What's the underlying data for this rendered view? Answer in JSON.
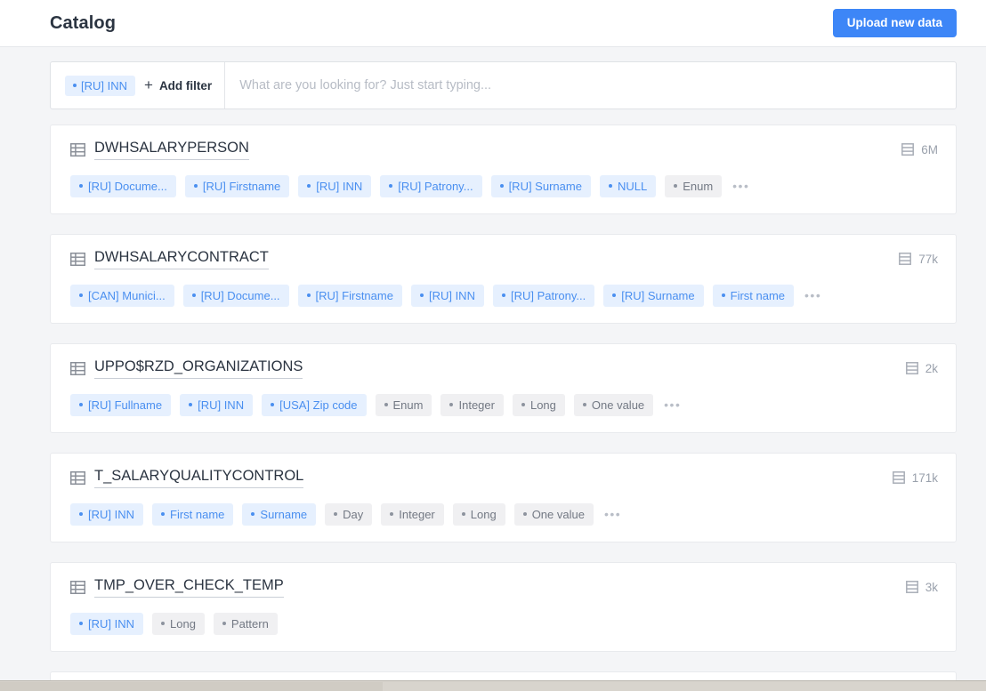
{
  "header": {
    "title": "Catalog",
    "upload_label": "Upload new data"
  },
  "search": {
    "placeholder": "What are you looking for? Just start typing...",
    "value": "",
    "active_filter": "[RU] INN",
    "add_filter_label": "Add filter",
    "plus_glyph": "+"
  },
  "icons": {
    "table": "table-icon",
    "rows": "rows-count-icon",
    "more": "•••"
  },
  "cards": [
    {
      "name": "DWHSALARYPERSON",
      "rows": "6M",
      "has_more": true,
      "tags": [
        {
          "label": "[RU] Docume...",
          "kind": "blue"
        },
        {
          "label": "[RU] Firstname",
          "kind": "blue"
        },
        {
          "label": "[RU] INN",
          "kind": "blue"
        },
        {
          "label": "[RU] Patrony...",
          "kind": "blue"
        },
        {
          "label": "[RU] Surname",
          "kind": "blue"
        },
        {
          "label": "NULL",
          "kind": "blue"
        },
        {
          "label": "Enum",
          "kind": "grey"
        }
      ]
    },
    {
      "name": "DWHSALARYCONTRACT",
      "rows": "77k",
      "has_more": true,
      "tags": [
        {
          "label": "[CAN] Munici...",
          "kind": "blue"
        },
        {
          "label": "[RU] Docume...",
          "kind": "blue"
        },
        {
          "label": "[RU] Firstname",
          "kind": "blue"
        },
        {
          "label": "[RU] INN",
          "kind": "blue"
        },
        {
          "label": "[RU] Patrony...",
          "kind": "blue"
        },
        {
          "label": "[RU] Surname",
          "kind": "blue"
        },
        {
          "label": "First name",
          "kind": "blue"
        }
      ]
    },
    {
      "name": "UPPO$RZD_ORGANIZATIONS",
      "rows": "2k",
      "has_more": true,
      "tags": [
        {
          "label": "[RU] Fullname",
          "kind": "blue"
        },
        {
          "label": "[RU] INN",
          "kind": "blue"
        },
        {
          "label": "[USA] Zip code",
          "kind": "blue"
        },
        {
          "label": "Enum",
          "kind": "grey"
        },
        {
          "label": "Integer",
          "kind": "grey"
        },
        {
          "label": "Long",
          "kind": "grey"
        },
        {
          "label": "One value",
          "kind": "grey"
        }
      ]
    },
    {
      "name": "T_SALARYQUALITYCONTROL",
      "rows": "171k",
      "has_more": true,
      "tags": [
        {
          "label": "[RU] INN",
          "kind": "blue"
        },
        {
          "label": "First name",
          "kind": "blue"
        },
        {
          "label": "Surname",
          "kind": "blue"
        },
        {
          "label": "Day",
          "kind": "grey"
        },
        {
          "label": "Integer",
          "kind": "grey"
        },
        {
          "label": "Long",
          "kind": "grey"
        },
        {
          "label": "One value",
          "kind": "grey"
        }
      ]
    },
    {
      "name": "TMP_OVER_CHECK_TEMP",
      "rows": "3k",
      "has_more": false,
      "tags": [
        {
          "label": "[RU] INN",
          "kind": "blue"
        },
        {
          "label": "Long",
          "kind": "grey"
        },
        {
          "label": "Pattern",
          "kind": "grey"
        }
      ]
    },
    {
      "name": "",
      "rows": "",
      "has_more": false,
      "tags": []
    }
  ]
}
